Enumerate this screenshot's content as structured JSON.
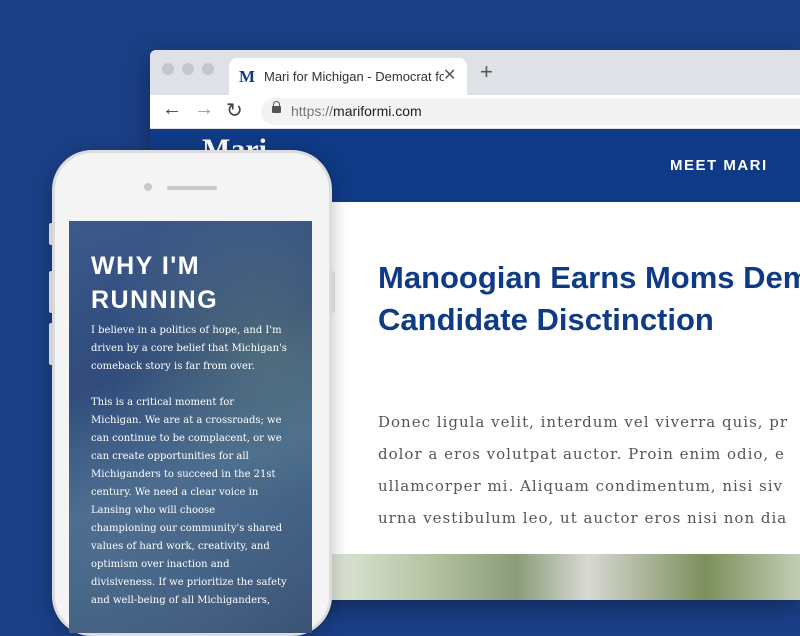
{
  "browser": {
    "tab_title": "Mari for Michigan - Democrat for",
    "tab_favicon": "M",
    "url_scheme": "https://",
    "url_host": "mariformi.com",
    "icons": [
      "back-icon",
      "forward-icon",
      "reload-icon",
      "lock-icon",
      "close-icon",
      "new-tab-icon"
    ]
  },
  "site": {
    "logo": "Mari",
    "nav_item": "MEET MARI",
    "article_title": [
      "Manoogian Earns Moms Dema",
      "Candidate Disctinction"
    ],
    "article_lines": [
      "Donec ligula velit, interdum vel viverra quis, pr",
      "dolor a eros volutpat auctor. Proin enim odio, e",
      "ullamcorper mi. Aliquam condimentum, nisi siv",
      "urna vestibulum leo, ut auctor eros nisi non dia"
    ]
  },
  "phone": {
    "title": [
      "WHY I'M",
      "RUNNING"
    ],
    "para1": [
      "I believe in a politics of hope, and I'm",
      "driven by a core belief that Michigan's",
      "comeback story is far from over."
    ],
    "para2": [
      "This is a critical moment for",
      "Michigan. We are at a crossroads; we",
      "can continue to be complacent, or we",
      "can create opportunities for all",
      "Michiganders to succeed in the 21st",
      "century. We need a clear voice in",
      "Lansing who will choose",
      "championing our community's shared",
      "values of hard work, creativity, and",
      "optimism over inaction and",
      "divisiveness. If we prioritize the safety",
      "and well-being of all Michiganders,"
    ]
  },
  "colors": {
    "background": "#1b3f86",
    "brand_navy": "#0f3a85"
  }
}
